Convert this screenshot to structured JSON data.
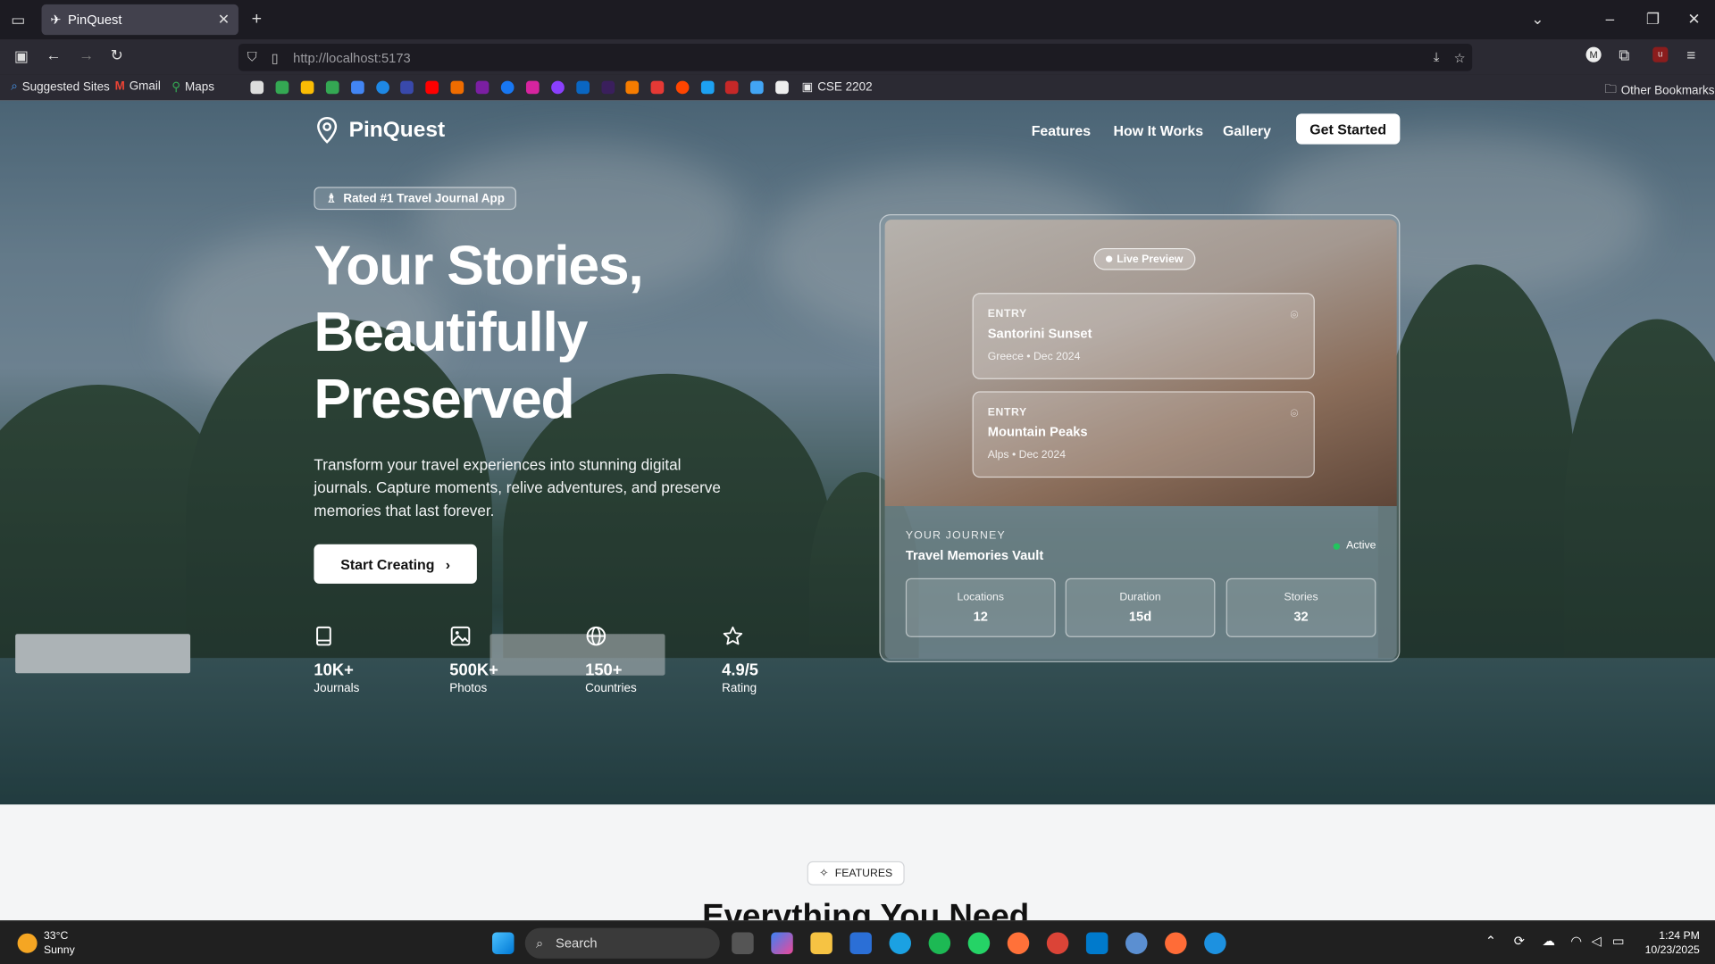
{
  "browser": {
    "tab_title": "PinQuest",
    "url": "http://localhost:5173",
    "bookmarks": [
      "Suggested Sites",
      "Gmail",
      "Maps",
      "CSE 2202"
    ],
    "other_bookmarks": "Other Bookmarks"
  },
  "site": {
    "brand": "PinQuest",
    "nav": [
      "Features",
      "How It Works",
      "Gallery"
    ],
    "get_started": "Get Started",
    "badge": "Rated #1 Travel Journal App",
    "headline": [
      "Your Stories,",
      "Beautifully",
      "Preserved"
    ],
    "subtitle": "Transform your travel experiences into stunning digital journals. Capture moments, relive adventures, and preserve memories that last forever.",
    "cta": "Start Creating",
    "stats": [
      {
        "icon": "book-icon",
        "value": "10K+",
        "label": "Journals"
      },
      {
        "icon": "image-icon",
        "value": "500K+",
        "label": "Photos"
      },
      {
        "icon": "globe-icon",
        "value": "150+",
        "label": "Countries"
      },
      {
        "icon": "star-icon",
        "value": "4.9/5",
        "label": "Rating"
      }
    ],
    "preview": {
      "live": "Live Preview",
      "entries": [
        {
          "kicker": "ENTRY",
          "title": "Santorini Sunset",
          "meta": "Greece • Dec 2024"
        },
        {
          "kicker": "ENTRY",
          "title": "Mountain Peaks",
          "meta": "Alps • Dec 2024"
        }
      ],
      "journey_label": "YOUR JOURNEY",
      "journey_title": "Travel Memories Vault",
      "status": "Active",
      "metrics": [
        {
          "label": "Locations",
          "value": "12"
        },
        {
          "label": "Duration",
          "value": "15d"
        },
        {
          "label": "Stories",
          "value": "32"
        }
      ]
    },
    "features_badge": "FEATURES",
    "features_heading": "Everything You Need"
  },
  "taskbar": {
    "weather_temp": "33°C",
    "weather_desc": "Sunny",
    "search": "Search",
    "time": "1:24 PM",
    "date": "10/23/2025"
  },
  "colors": {
    "accent": "#ffffff",
    "active_dot": "#22c55e",
    "page_bg": "#f4f5f6"
  }
}
